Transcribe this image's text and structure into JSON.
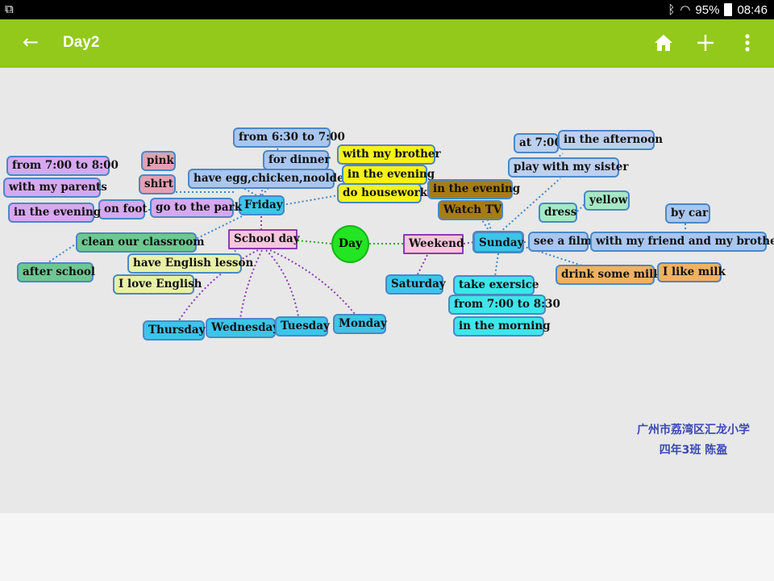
{
  "status_bar": {
    "left_icon": "notification-icon",
    "battery": "95%",
    "time": "08:46"
  },
  "app_bar": {
    "title": "Day2",
    "actions": [
      "home-icon",
      "add-icon",
      "more-icon"
    ]
  },
  "map": {
    "root": "Day",
    "school_day": "School day",
    "weekend": "Weekend",
    "friday": "Friday",
    "sunday": "Sunday",
    "saturday": "Saturday",
    "thursday": "Thursday",
    "wednesday": "Wednesday",
    "tuesday": "Tuesday",
    "monday": "Monday",
    "from_630": "from 6:30 to 7:00",
    "for_dinner": "for dinner",
    "have_egg": "have egg,chicken,nooldes",
    "with_brother": "with my brother",
    "in_evening_y": "in the evening",
    "do_housework": "do housework",
    "pink": "pink",
    "shirt": "shirt",
    "go_park": "go to the park",
    "on_foot": "on foot",
    "from_700": "from 7:00  to  8:00",
    "with_parents": "with my parents",
    "in_evening_l": "in the evening",
    "clean": "clean our  classroom",
    "after_school": "after  school",
    "english_lesson": "have English lesson",
    "love_english": "I love English",
    "in_evening_b": "in the evening",
    "watch_tv": "Watch  TV",
    "at_700": "at 7:00",
    "afternoon": "in the afternoon",
    "play_sister": "play with my sister",
    "dress": "dress",
    "yellow": "yellow",
    "by_car": "by car",
    "see_film": "see a film",
    "with_friend": "with my friend and my brother",
    "drink_milk": "drink some milk",
    "like_milk": "I like milk",
    "take_exersice": "take exersice",
    "from_700_830": "from 7:00 to 8:30",
    "morning": "in the morning"
  },
  "signature": {
    "line1": "广州市荔湾区汇龙小学",
    "line2": "四年3班  陈盈"
  },
  "colors": {
    "app_bar": "#92c91b",
    "canvas": "#e8e8e8",
    "root": "#23e523",
    "link_green": "#22aa22",
    "link_purple": "#8a3bb3",
    "link_blue": "#3d88c8",
    "signature": "#3a48b4"
  }
}
